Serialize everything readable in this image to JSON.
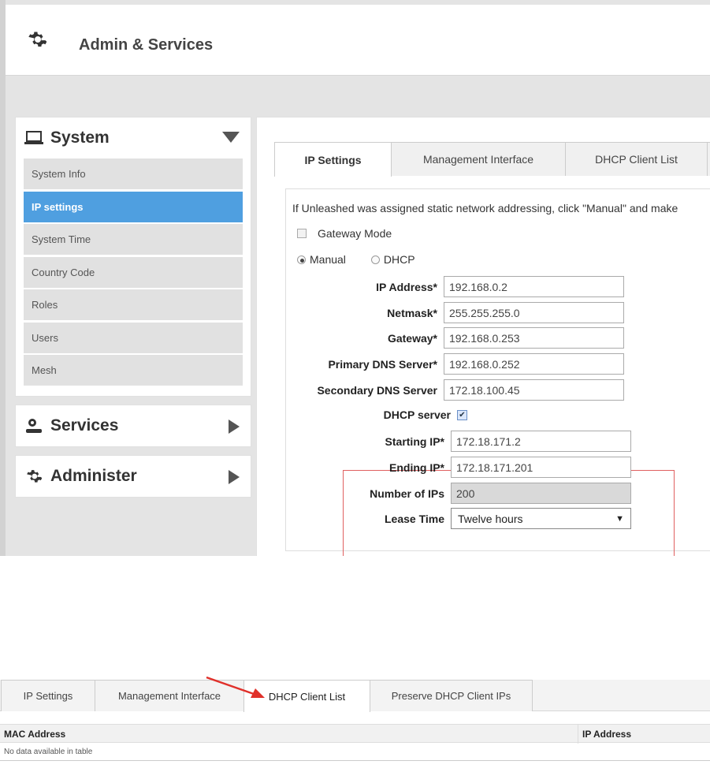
{
  "header": {
    "title": "Admin & Services"
  },
  "sidebar": {
    "system": {
      "label": "System",
      "items": [
        {
          "label": "System Info"
        },
        {
          "label": "IP settings"
        },
        {
          "label": "System Time"
        },
        {
          "label": "Country Code"
        },
        {
          "label": "Roles"
        },
        {
          "label": "Users"
        },
        {
          "label": "Mesh"
        }
      ]
    },
    "services": {
      "label": "Services"
    },
    "administer": {
      "label": "Administer"
    }
  },
  "tabs": [
    {
      "label": "IP Settings"
    },
    {
      "label": "Management Interface"
    },
    {
      "label": "DHCP Client List"
    }
  ],
  "ip_settings": {
    "intro": "If Unleashed was assigned static network addressing, click \"Manual\" and make",
    "gateway_mode": "Gateway Mode",
    "manual": "Manual",
    "dhcp": "DHCP",
    "fields": {
      "ip_address": {
        "label": "IP Address*",
        "value": "192.168.0.2"
      },
      "netmask": {
        "label": "Netmask*",
        "value": "255.255.255.0"
      },
      "gateway": {
        "label": "Gateway*",
        "value": "192.168.0.253"
      },
      "primary_dns": {
        "label": "Primary DNS Server*",
        "value": "192.168.0.252"
      },
      "secondary_dns": {
        "label": "Secondary DNS Server",
        "value": "172.18.100.45"
      }
    },
    "dhcp_server": {
      "label": "DHCP server",
      "starting_ip": {
        "label": "Starting IP*",
        "value": "172.18.171.2"
      },
      "ending_ip": {
        "label": "Ending IP*",
        "value": "172.18.171.201"
      },
      "num_ips": {
        "label": "Number of IPs",
        "value": "200"
      },
      "lease_time": {
        "label": "Lease Time",
        "value": "Twelve hours"
      }
    }
  },
  "bottom": {
    "tabs": [
      {
        "label": "IP Settings"
      },
      {
        "label": "Management Interface"
      },
      {
        "label": "DHCP Client List"
      },
      {
        "label": "Preserve DHCP Client IPs"
      }
    ],
    "table": {
      "columns": [
        "MAC Address",
        "IP Address"
      ],
      "empty": "No data available in table"
    }
  },
  "colors": {
    "accent": "#4f9fe0",
    "highlight_box": "#e06060",
    "annotation_arrow": "#e0302a"
  }
}
